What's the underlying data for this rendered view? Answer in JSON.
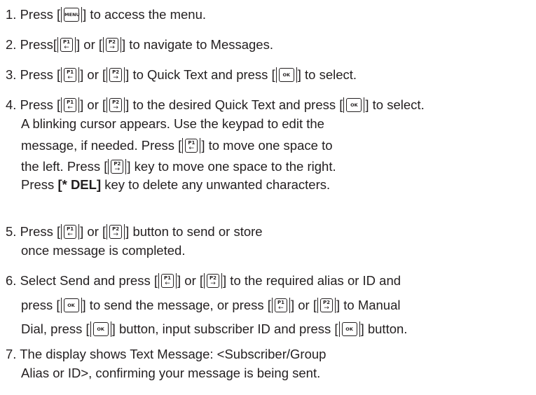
{
  "keys": {
    "menu": "MENU",
    "ok": "OK",
    "p1": "P1",
    "p2": "P2",
    "left_arrow": "←",
    "right_arrow": "→"
  },
  "steps": [
    {
      "num": "1.",
      "parts": [
        "Press [",
        "] to access the menu."
      ]
    },
    {
      "num": "2.",
      "parts": [
        "Press[",
        "] or [",
        "] to navigate to Messages."
      ]
    },
    {
      "num": "3.",
      "parts": [
        "Press [",
        "] or [",
        "] to Quick Text and press [",
        "] to select."
      ]
    },
    {
      "num": "4.",
      "parts": [
        "Press [",
        "] or [",
        "] to the desired Quick Text and press [",
        "] to select."
      ],
      "lines": [
        "A blinking cursor appears. Use the keypad to edit the",
        [
          "message, if needed. Press [",
          "] to move one space to"
        ],
        [
          "the left. Press [",
          "] key to move one space to the right."
        ],
        [
          "Press ",
          "[* DEL]",
          " key to delete any unwanted characters."
        ]
      ]
    },
    {
      "num": "5.",
      "parts": [
        "Press [",
        "] or [",
        "] button to send or store"
      ],
      "lines": [
        "once message is completed."
      ]
    },
    {
      "num": "6.",
      "parts": [
        "Select Send and press [",
        "] or [",
        "] to the required alias or ID and"
      ],
      "lines": [
        [
          "press [",
          "] to send the message, or press [",
          "] or [",
          "] to Manual"
        ],
        [
          "Dial, press [",
          "] button, input subscriber ID and press [",
          "] button."
        ]
      ]
    },
    {
      "num": "7.",
      "parts": [
        "The display shows Text Message: <Subscriber/Group"
      ],
      "lines": [
        "Alias or ID>, confirming your message is being sent."
      ]
    }
  ]
}
